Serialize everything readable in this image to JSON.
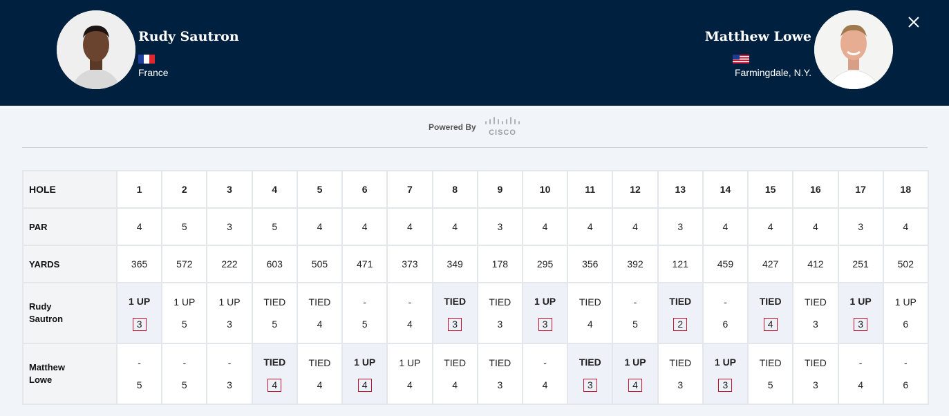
{
  "players": {
    "left": {
      "name": "Rudy Sautron",
      "location": "France",
      "flag": "france-flag-icon"
    },
    "right": {
      "name": "Matthew Lowe",
      "location": "Farmingdale, N.Y.",
      "flag": "usa-flag-icon"
    }
  },
  "powered_by": "Powered By",
  "sponsor": "CISCO",
  "colors": {
    "header_bg": "#00203f",
    "win_box": "#c8102e",
    "win_cell": "#eef2f8"
  },
  "scorecard": {
    "hole_label": "HOLE",
    "par_label": "PAR",
    "yards_label": "YARDS",
    "holes": [
      "1",
      "2",
      "3",
      "4",
      "5",
      "6",
      "7",
      "8",
      "9",
      "10",
      "11",
      "12",
      "13",
      "14",
      "15",
      "16",
      "17",
      "18"
    ],
    "par": [
      "4",
      "5",
      "3",
      "5",
      "4",
      "4",
      "4",
      "4",
      "3",
      "4",
      "4",
      "4",
      "3",
      "4",
      "4",
      "4",
      "3",
      "4"
    ],
    "yards": [
      "365",
      "572",
      "222",
      "603",
      "505",
      "471",
      "373",
      "349",
      "178",
      "295",
      "356",
      "392",
      "121",
      "459",
      "427",
      "412",
      "251",
      "502"
    ],
    "rows": [
      {
        "label": "Rudy\nSautron",
        "status": [
          "1 UP",
          "1 UP",
          "1 UP",
          "TIED",
          "TIED",
          "-",
          "-",
          "TIED",
          "TIED",
          "1 UP",
          "TIED",
          "-",
          "TIED",
          "-",
          "TIED",
          "TIED",
          "1 UP",
          "1 UP"
        ],
        "strokes": [
          "3",
          "5",
          "3",
          "5",
          "4",
          "5",
          "4",
          "3",
          "3",
          "3",
          "4",
          "5",
          "2",
          "6",
          "4",
          "3",
          "3",
          "6"
        ],
        "won": [
          true,
          false,
          false,
          false,
          false,
          false,
          false,
          true,
          false,
          true,
          false,
          false,
          true,
          false,
          true,
          false,
          true,
          false
        ]
      },
      {
        "label": "Matthew\nLowe",
        "status": [
          "-",
          "-",
          "-",
          "TIED",
          "TIED",
          "1 UP",
          "1 UP",
          "TIED",
          "TIED",
          "-",
          "TIED",
          "1 UP",
          "TIED",
          "1 UP",
          "TIED",
          "TIED",
          "-",
          "-"
        ],
        "strokes": [
          "5",
          "5",
          "3",
          "4",
          "4",
          "4",
          "4",
          "4",
          "3",
          "4",
          "3",
          "4",
          "3",
          "3",
          "5",
          "3",
          "4",
          "6"
        ],
        "won": [
          false,
          false,
          false,
          true,
          false,
          true,
          false,
          false,
          false,
          false,
          true,
          true,
          false,
          true,
          false,
          false,
          false,
          false
        ]
      }
    ]
  }
}
